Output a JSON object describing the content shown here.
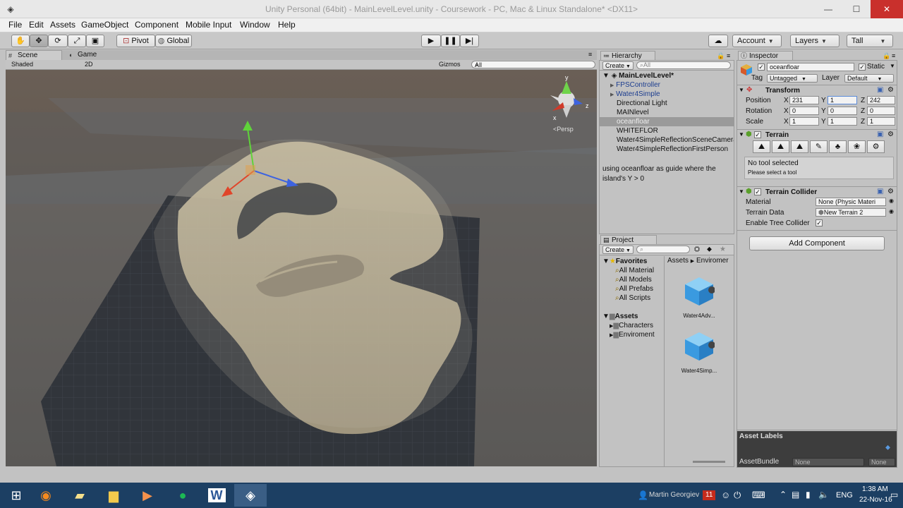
{
  "window": {
    "title": "Unity Personal (64bit) - MainLevelLevel.unity - Coursework - PC, Mac & Linux Standalone* <DX11>",
    "minimize": "—",
    "maximize": "☐",
    "close": "✕"
  },
  "menu": [
    "File",
    "Edit",
    "Assets",
    "GameObject",
    "Component",
    "Mobile Input",
    "Window",
    "Help"
  ],
  "toolbar": {
    "pivot": "Pivot",
    "global": "Global",
    "account": "Account",
    "layers": "Layers",
    "layout": "Tall"
  },
  "scene": {
    "tab_scene": "Scene",
    "tab_game": "Game",
    "shading": "Shaded",
    "mode_2d": "2D",
    "gizmos": "Gizmos",
    "search_placeholder": "All",
    "persp": "Persp",
    "gizmo_y": "y",
    "gizmo_x": "x",
    "gizmo_z": "z"
  },
  "hierarchy": {
    "tab": "Hierarchy",
    "create": "Create",
    "search_placeholder": "All",
    "root": "MainLevelLevel*",
    "items": [
      {
        "label": "FPSController",
        "expandable": true
      },
      {
        "label": "Water4Simple",
        "expandable": true
      },
      {
        "label": "Directional Light",
        "expandable": false
      },
      {
        "label": "MAINlevel",
        "expandable": false
      },
      {
        "label": "oceanfloar",
        "expandable": false
      },
      {
        "label": "WHITEFLOR",
        "expandable": false
      },
      {
        "label": "Water4SimpleReflectionSceneCamera",
        "expandable": false
      },
      {
        "label": "Water4SimpleReflectionFirstPerson",
        "expandable": false
      }
    ],
    "note": "using oceanfloar as guide where the island's Y > 0"
  },
  "project": {
    "tab": "Project",
    "create": "Create",
    "favorites": "Favorites",
    "favorite_items": [
      "All Material",
      "All Models",
      "All Prefabs",
      "All Scripts"
    ],
    "assets": "Assets",
    "asset_folders": [
      "Characters",
      "Enviroment"
    ],
    "breadcrumb_root": "Assets",
    "breadcrumb_child": "Enviromer",
    "tiles": [
      "Water4Adv...",
      "Water4Simp..."
    ]
  },
  "inspector": {
    "tab": "Inspector",
    "object_name": "oceanfloar",
    "static": "Static",
    "tag_label": "Tag",
    "tag_value": "Untagged",
    "layer_label": "Layer",
    "layer_value": "Default",
    "transform": {
      "title": "Transform",
      "position_label": "Position",
      "rotation_label": "Rotation",
      "scale_label": "Scale",
      "position": {
        "x": "231",
        "y": "1",
        "z": "242"
      },
      "rotation": {
        "x": "0",
        "y": "0",
        "z": "0"
      },
      "scale": {
        "x": "1",
        "y": "1",
        "z": "1"
      }
    },
    "axis": {
      "x": "X",
      "y": "Y",
      "z": "Z"
    },
    "terrain": {
      "title": "Terrain",
      "status": "No tool selected",
      "hint": "Please select a tool"
    },
    "collider": {
      "title": "Terrain Collider",
      "material_label": "Material",
      "material_value": "None (Physic Materi",
      "data_label": "Terrain Data",
      "data_value": "New Terrain 2",
      "tree_label": "Enable Tree Collider"
    },
    "add_component": "Add Component",
    "asset_labels": "Asset Labels",
    "asset_bundle": "AssetBundle",
    "bundle_value": "None",
    "bundle_variant": "None"
  },
  "taskbar": {
    "user": "Martin Georgiev",
    "badge": "11",
    "lang": "ENG",
    "time": "1:38 AM",
    "date": "22-Nov-16"
  }
}
